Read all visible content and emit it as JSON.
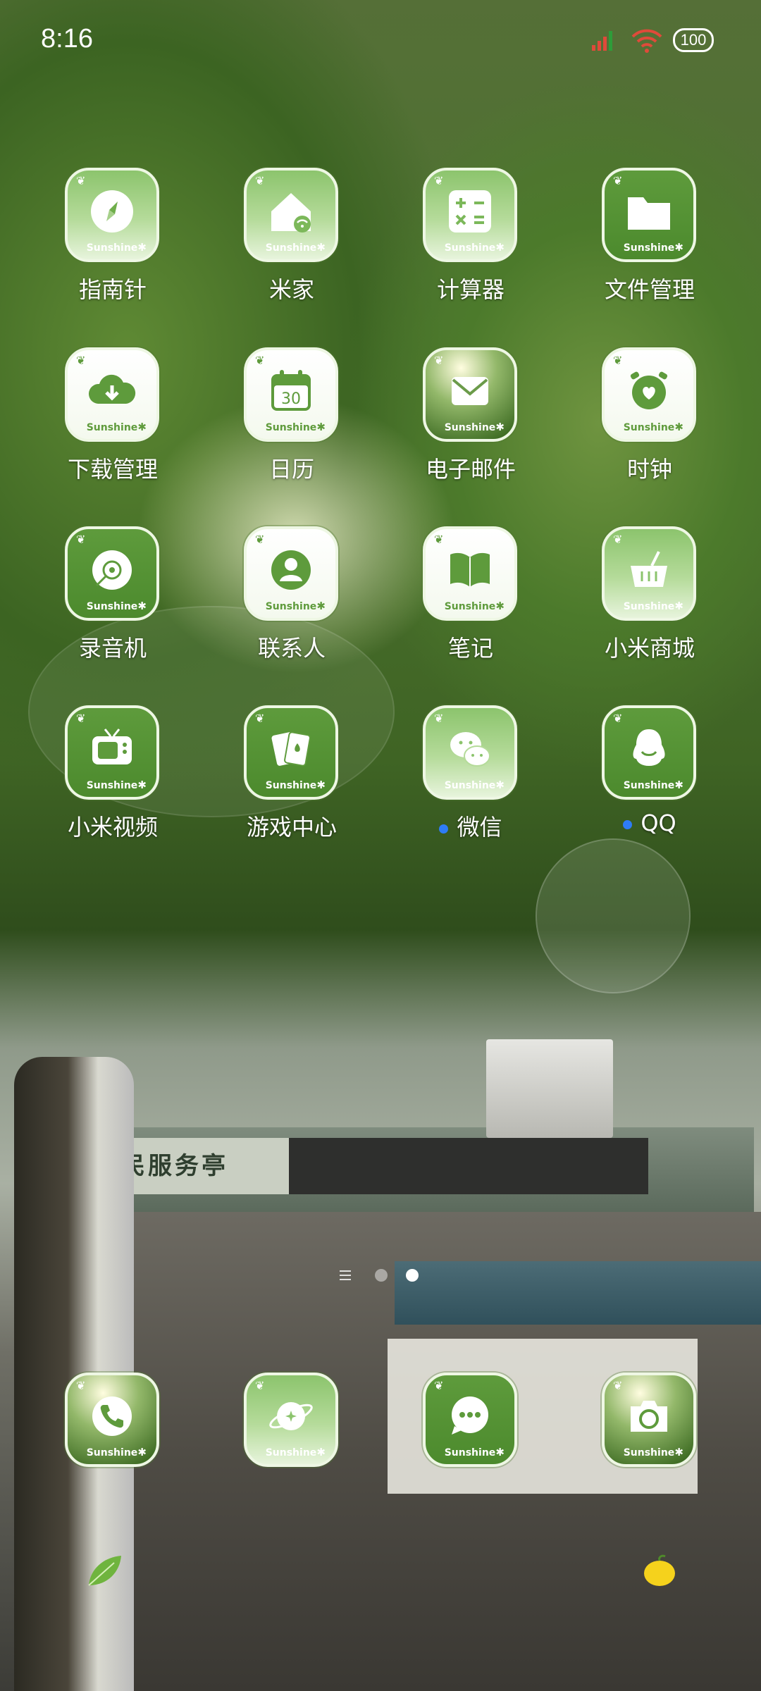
{
  "status_bar": {
    "time": "8:16",
    "battery": "100"
  },
  "brand": "Sunshine",
  "apps": [
    {
      "label": "指南针",
      "icon": "compass-icon"
    },
    {
      "label": "米家",
      "icon": "smart-home-icon"
    },
    {
      "label": "计算器",
      "icon": "calculator-icon"
    },
    {
      "label": "文件管理",
      "icon": "folder-icon"
    },
    {
      "label": "下载管理",
      "icon": "cloud-download-icon"
    },
    {
      "label": "日历",
      "icon": "calendar-icon",
      "day": "30"
    },
    {
      "label": "电子邮件",
      "icon": "mail-icon"
    },
    {
      "label": "时钟",
      "icon": "alarm-clock-icon"
    },
    {
      "label": "录音机",
      "icon": "recorder-icon"
    },
    {
      "label": "联系人",
      "icon": "contacts-icon"
    },
    {
      "label": "笔记",
      "icon": "notes-icon"
    },
    {
      "label": "小米商城",
      "icon": "shopping-basket-icon"
    },
    {
      "label": "小米视频",
      "icon": "tv-icon"
    },
    {
      "label": "游戏中心",
      "icon": "game-cards-icon"
    },
    {
      "label": "微信",
      "icon": "wechat-icon"
    },
    {
      "label": "QQ",
      "icon": "qq-icon"
    }
  ],
  "dock": [
    {
      "icon": "phone-icon"
    },
    {
      "icon": "browser-planet-icon"
    },
    {
      "icon": "messages-icon"
    },
    {
      "icon": "camera-icon"
    }
  ],
  "colors": {
    "accent_green": "#5e9b3c",
    "notification_dot": "#2e7cf6"
  }
}
